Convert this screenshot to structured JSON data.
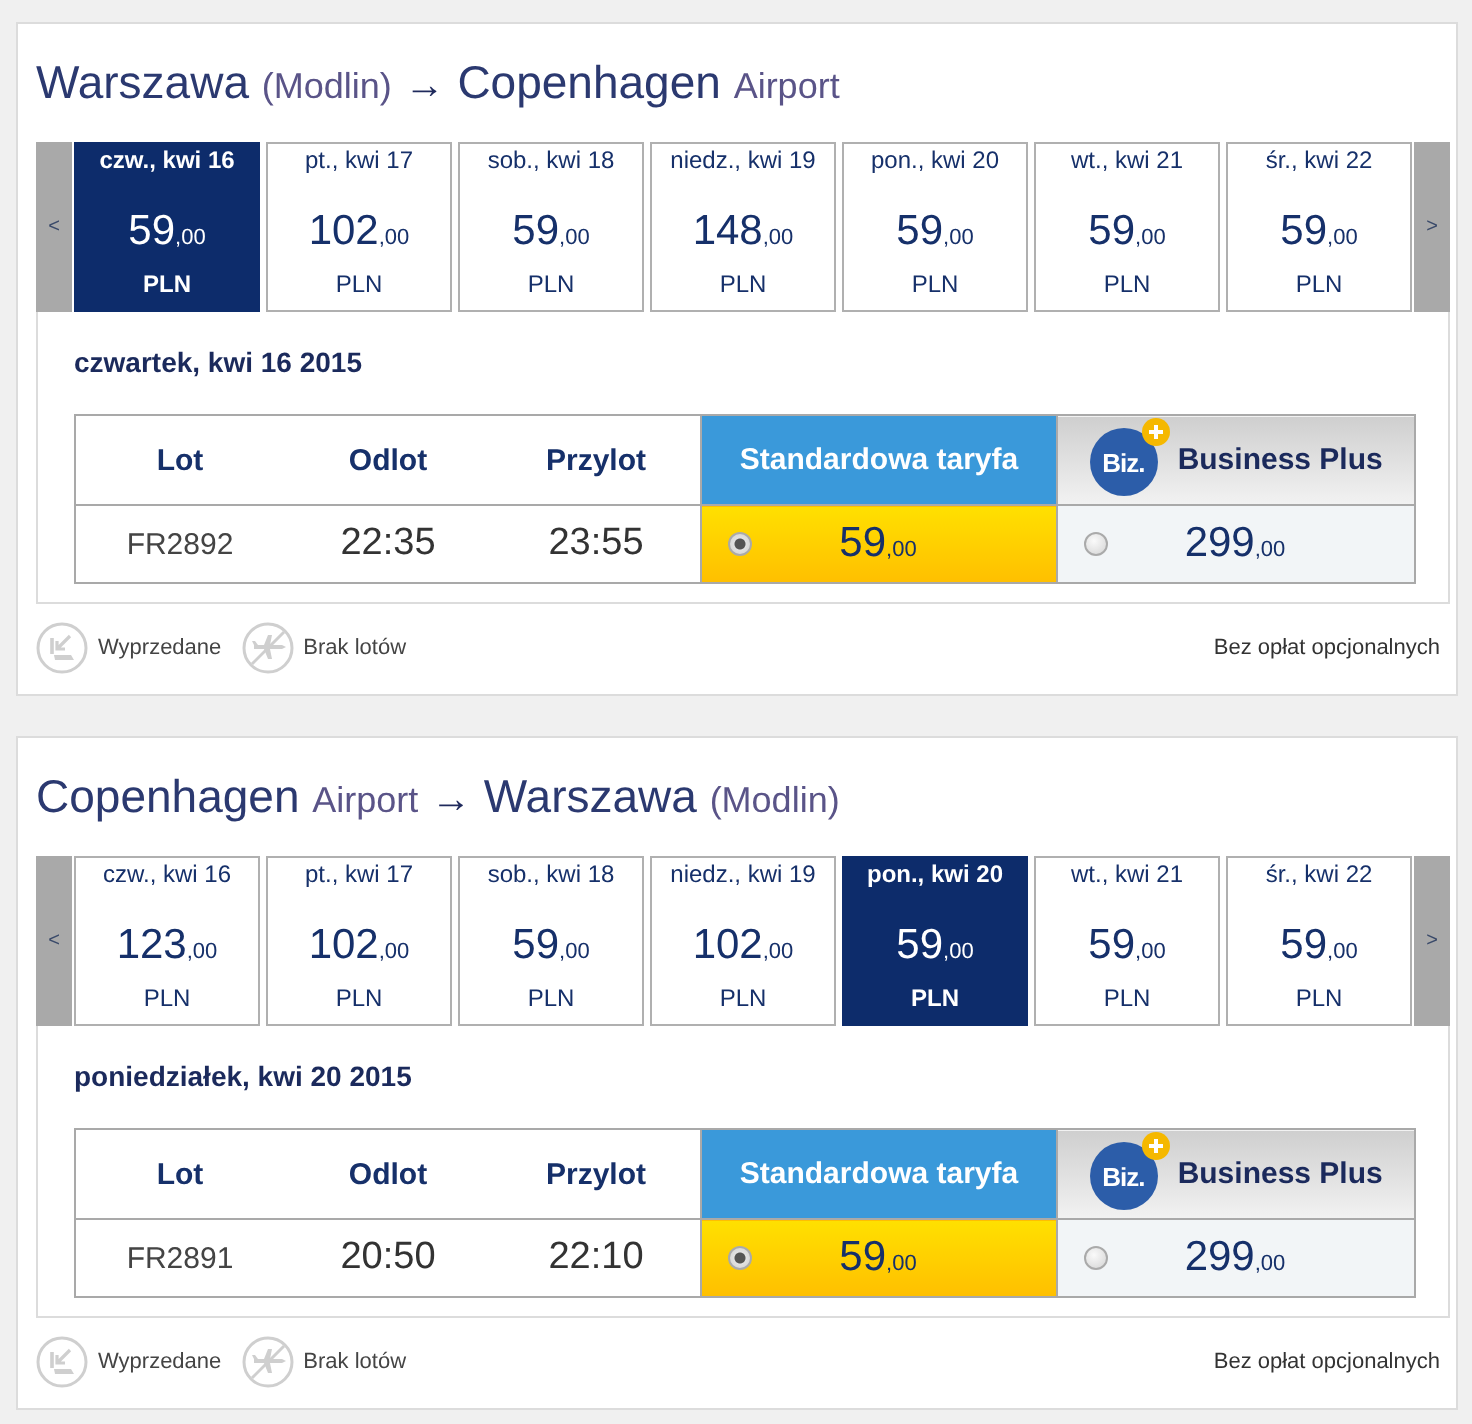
{
  "routes": [
    {
      "title": {
        "origin": "Warszawa",
        "origin_note": "(Modlin)",
        "arrow": "→",
        "destination": "Copenhagen",
        "destination_note": "Airport"
      },
      "prev": "<",
      "next": ">",
      "days": [
        {
          "label": "czw., kwi 16",
          "price": "59",
          "decimals": ",00",
          "currency": "PLN",
          "selected": true
        },
        {
          "label": "pt., kwi 17",
          "price": "102",
          "decimals": ",00",
          "currency": "PLN",
          "selected": false
        },
        {
          "label": "sob., kwi 18",
          "price": "59",
          "decimals": ",00",
          "currency": "PLN",
          "selected": false
        },
        {
          "label": "niedz., kwi 19",
          "price": "148",
          "decimals": ",00",
          "currency": "PLN",
          "selected": false
        },
        {
          "label": "pon., kwi 20",
          "price": "59",
          "decimals": ",00",
          "currency": "PLN",
          "selected": false
        },
        {
          "label": "wt., kwi 21",
          "price": "59",
          "decimals": ",00",
          "currency": "PLN",
          "selected": false
        },
        {
          "label": "śr., kwi 22",
          "price": "59",
          "decimals": ",00",
          "currency": "PLN",
          "selected": false
        }
      ],
      "date_heading": "czwartek, kwi 16 2015",
      "table": {
        "columns": [
          "Lot",
          "Odlot",
          "Przylot"
        ],
        "fares": [
          {
            "kind": "standard",
            "label": "Standardowa taryfa"
          },
          {
            "kind": "business",
            "label": "Business Plus",
            "badge": "Biz."
          }
        ],
        "rows": [
          {
            "flight": "FR2892",
            "departure": "22:35",
            "arrival": "23:55",
            "fares": [
              {
                "price": "59",
                "decimals": ",00",
                "selected": true
              },
              {
                "price": "299",
                "decimals": ",00",
                "selected": false
              }
            ]
          }
        ]
      },
      "legend": [
        {
          "kind": "sold-out",
          "label": "Wyprzedane"
        },
        {
          "kind": "no-flights",
          "label": "Brak lotów"
        }
      ],
      "note": "Bez opłat opcjonalnych"
    },
    {
      "title": {
        "origin": "Copenhagen",
        "origin_note": "Airport",
        "arrow": "→",
        "destination": "Warszawa",
        "destination_note": "(Modlin)"
      },
      "prev": "<",
      "next": ">",
      "days": [
        {
          "label": "czw., kwi 16",
          "price": "123",
          "decimals": ",00",
          "currency": "PLN",
          "selected": false
        },
        {
          "label": "pt., kwi 17",
          "price": "102",
          "decimals": ",00",
          "currency": "PLN",
          "selected": false
        },
        {
          "label": "sob., kwi 18",
          "price": "59",
          "decimals": ",00",
          "currency": "PLN",
          "selected": false
        },
        {
          "label": "niedz., kwi 19",
          "price": "102",
          "decimals": ",00",
          "currency": "PLN",
          "selected": false
        },
        {
          "label": "pon., kwi 20",
          "price": "59",
          "decimals": ",00",
          "currency": "PLN",
          "selected": true
        },
        {
          "label": "wt., kwi 21",
          "price": "59",
          "decimals": ",00",
          "currency": "PLN",
          "selected": false
        },
        {
          "label": "śr., kwi 22",
          "price": "59",
          "decimals": ",00",
          "currency": "PLN",
          "selected": false
        }
      ],
      "date_heading": "poniedziałek, kwi 20 2015",
      "table": {
        "columns": [
          "Lot",
          "Odlot",
          "Przylot"
        ],
        "fares": [
          {
            "kind": "standard",
            "label": "Standardowa taryfa"
          },
          {
            "kind": "business",
            "label": "Business Plus",
            "badge": "Biz."
          }
        ],
        "rows": [
          {
            "flight": "FR2891",
            "departure": "20:50",
            "arrival": "22:10",
            "fares": [
              {
                "price": "59",
                "decimals": ",00",
                "selected": true
              },
              {
                "price": "299",
                "decimals": ",00",
                "selected": false
              }
            ]
          }
        ]
      },
      "legend": [
        {
          "kind": "sold-out",
          "label": "Wyprzedane"
        },
        {
          "kind": "no-flights",
          "label": "Brak lotów"
        }
      ],
      "note": "Bez opłat opcjonalnych"
    }
  ]
}
